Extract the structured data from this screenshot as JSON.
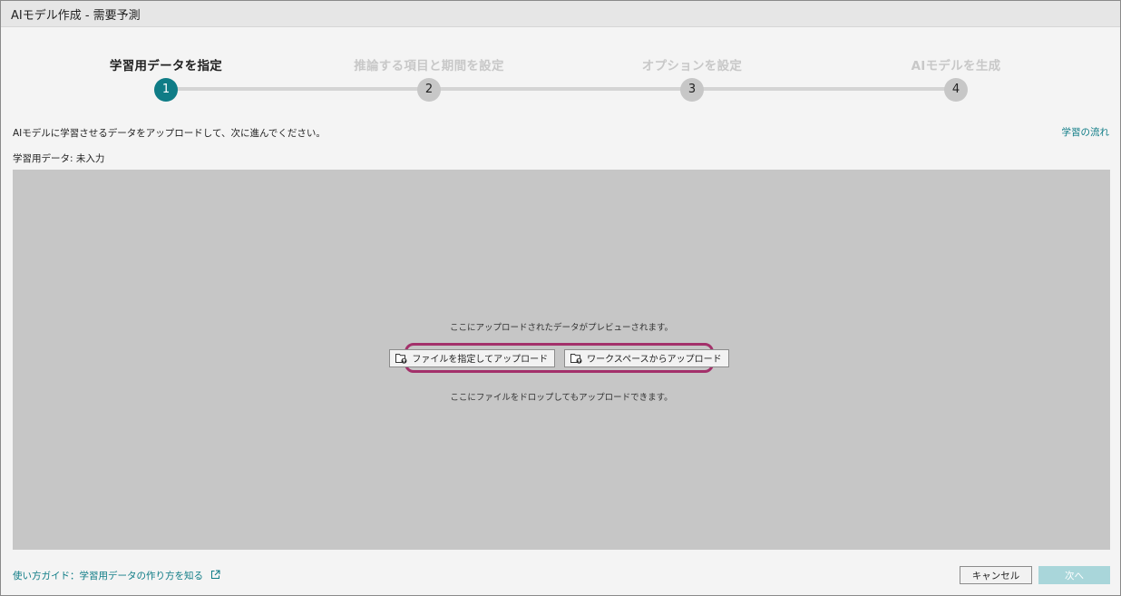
{
  "window": {
    "title": "AIモデル作成 - 需要予測"
  },
  "stepper": {
    "steps": [
      {
        "label": "学習用データを指定",
        "number": "1",
        "active": true
      },
      {
        "label": "推論する項目と期間を設定",
        "number": "2",
        "active": false
      },
      {
        "label": "オプションを設定",
        "number": "3",
        "active": false
      },
      {
        "label": "AIモデルを生成",
        "number": "4",
        "active": false
      }
    ]
  },
  "main": {
    "instruction": "AIモデルに学習させるデータをアップロードして、次に進んでください。",
    "flow_link": "学習の流れ",
    "data_status": "学習用データ: 未入力",
    "preview": {
      "message_top": "ここにアップロードされたデータがプレビューされます。",
      "upload_file_label": "ファイルを指定してアップロード",
      "upload_workspace_label": "ワークスペースからアップロード",
      "message_bottom": "ここにファイルをドロップしてもアップロードできます。"
    }
  },
  "footer": {
    "guide_link": "使い方ガイド：学習用データの作り方を知る",
    "cancel_label": "キャンセル",
    "next_label": "次へ"
  },
  "colors": {
    "accent": "#0f7c86",
    "highlight_border": "#a3306a",
    "next_disabled": "#a9d6da",
    "preview_bg": "#c6c6c6"
  },
  "icons": {
    "upload_file": "folder-upload-icon",
    "upload_workspace": "folder-upload-icon",
    "guide": "external-link-icon"
  }
}
